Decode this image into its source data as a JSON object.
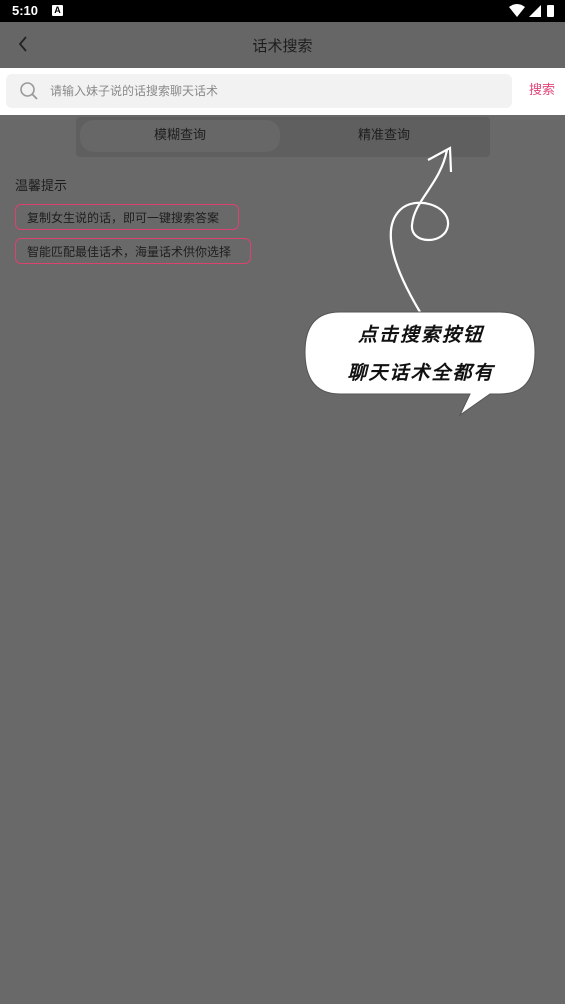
{
  "status_bar": {
    "time": "5:10",
    "notification_icon": "A"
  },
  "header": {
    "title": "话术搜索",
    "back_icon": "chevron-left"
  },
  "search": {
    "placeholder": "请输入妹子说的话搜索聊天话术",
    "value": "",
    "button_label": "搜索",
    "accent_color": "#e0457a"
  },
  "tabs": [
    {
      "label": "模糊查询",
      "selected": true
    },
    {
      "label": "精准查询",
      "selected": false
    }
  ],
  "tips": {
    "title": "温馨提示",
    "items": [
      "复制女生说的话，即可一键搜索答案",
      "智能匹配最佳话术，海量话术供你选择"
    ]
  },
  "annotation": {
    "line1": "点击搜索按钮",
    "line2": "聊天话术全都有"
  }
}
